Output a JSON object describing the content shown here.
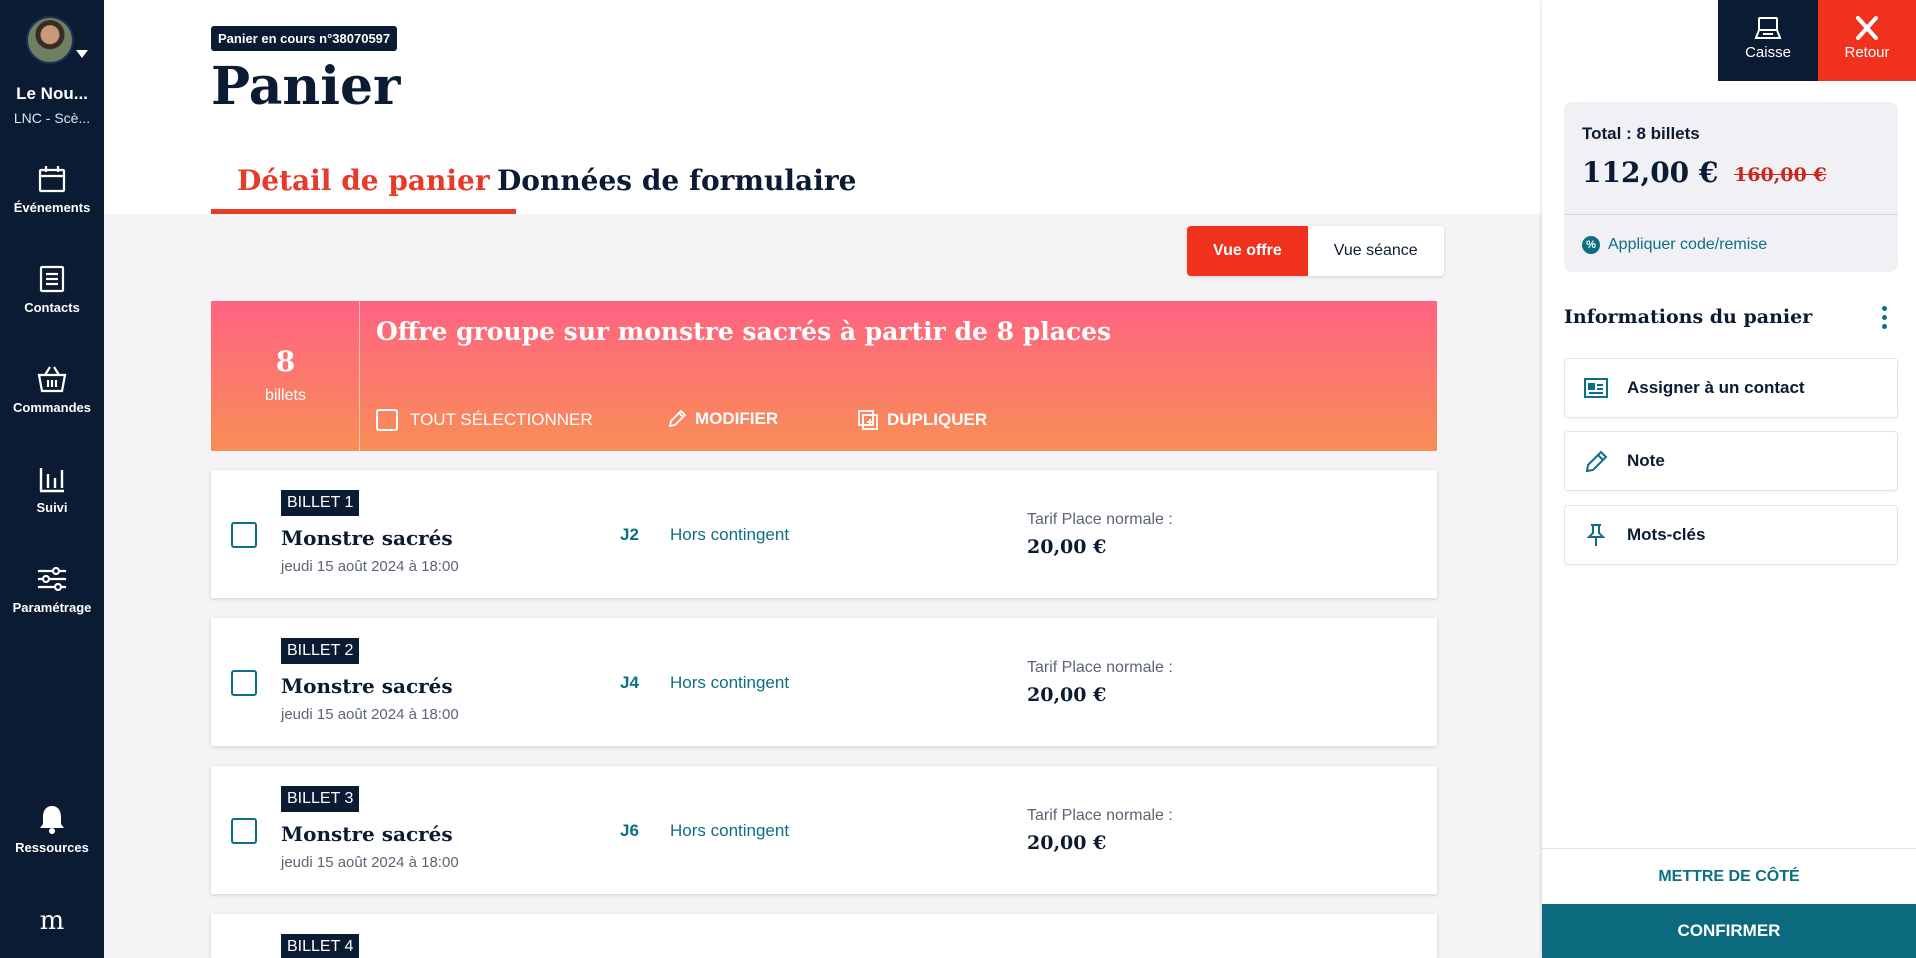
{
  "sidebar": {
    "org_name": "Le Nou...",
    "org_sub": "LNC - Scè...",
    "items": [
      {
        "label": "Événements",
        "icon": "calendar-icon"
      },
      {
        "label": "Contacts",
        "icon": "contact-list-icon"
      },
      {
        "label": "Commandes",
        "icon": "basket-icon"
      },
      {
        "label": "Suivi",
        "icon": "bar-chart-icon"
      },
      {
        "label": "Paramétrage",
        "icon": "sliders-icon"
      }
    ],
    "resources_label": "Ressources",
    "logo": "m"
  },
  "header": {
    "cart_badge": "Panier en cours n°38070597",
    "title": "Panier",
    "tabs": [
      {
        "label": "Détail de panier",
        "active": true
      },
      {
        "label": "Données de formulaire",
        "active": false
      }
    ]
  },
  "view_toggle": {
    "offer": "Vue offre",
    "session": "Vue séance"
  },
  "offer": {
    "count": "8",
    "count_label": "billets",
    "title": "Offre groupe sur monstre sacrés à partir de 8 places",
    "select_all": "TOUT SÉLECTIONNER",
    "modify": "MODIFIER",
    "duplicate": "DUPLIQUER"
  },
  "tickets": [
    {
      "tag": "BILLET 1",
      "name": "Monstre sacrés",
      "date": "jeudi 15 août 2024 à 18:00",
      "seat": "J2",
      "quota": "Hors contingent",
      "price_label": "Tarif Place normale :",
      "price": "20,00 €"
    },
    {
      "tag": "BILLET 2",
      "name": "Monstre sacrés",
      "date": "jeudi 15 août 2024 à 18:00",
      "seat": "J4",
      "quota": "Hors contingent",
      "price_label": "Tarif Place normale :",
      "price": "20,00 €"
    },
    {
      "tag": "BILLET 3",
      "name": "Monstre sacrés",
      "date": "jeudi 15 août 2024 à 18:00",
      "seat": "J6",
      "quota": "Hors contingent",
      "price_label": "Tarif Place normale :",
      "price": "20,00 €"
    },
    {
      "tag": "BILLET 4"
    }
  ],
  "right_panel": {
    "caisse": "Caisse",
    "retour": "Retour",
    "total_label": "Total : 8 billets",
    "total_price": "112,00 €",
    "old_price": "160,00 €",
    "promo": "Appliquer code/remise",
    "promo_icon": "%",
    "info_title": "Informations du panier",
    "info_items": [
      {
        "label": "Assigner à un contact",
        "icon": "contact-card-icon"
      },
      {
        "label": "Note",
        "icon": "pencil-icon"
      },
      {
        "label": "Mots-clés",
        "icon": "pin-icon"
      }
    ],
    "set_aside": "METTRE DE CÔTÉ",
    "confirm": "CONFIRMER"
  },
  "colors": {
    "navy": "#0b1b33",
    "accent_red": "#f0311d",
    "teal": "#0d6f84",
    "banner_top": "#ff6382",
    "banner_bottom": "#f88e56"
  }
}
